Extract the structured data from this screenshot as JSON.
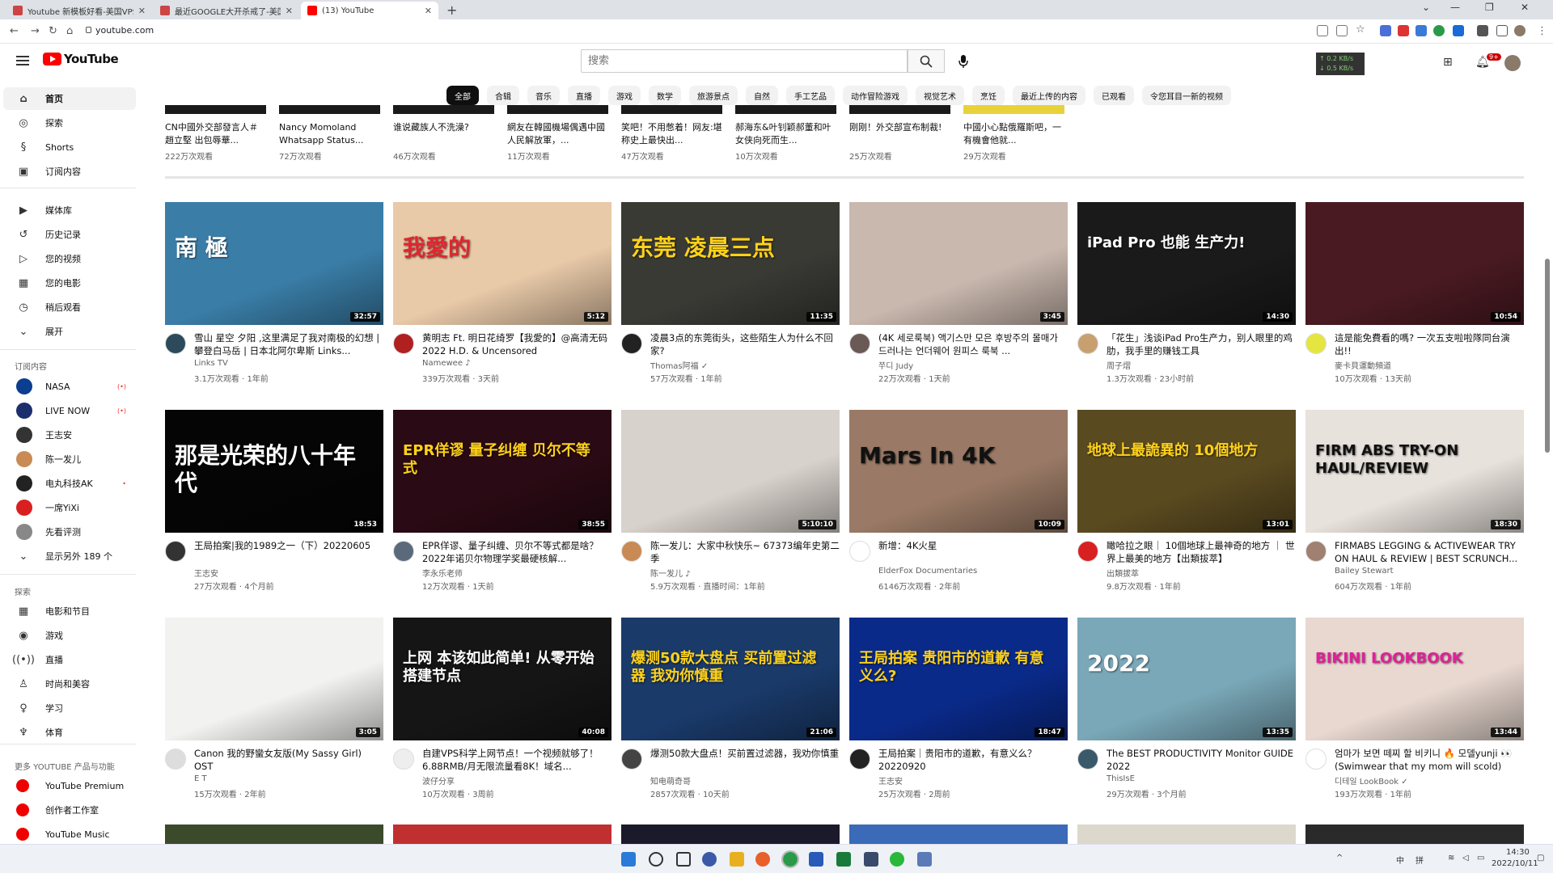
{
  "browser": {
    "tabs": [
      {
        "title": "Youtube 新模板好看-美国VPS..."
      },
      {
        "title": "最近GOOGLE大开杀戒了-美国V..."
      },
      {
        "title": "(13) YouTube"
      }
    ],
    "url": "youtube.com",
    "window_controls": {
      "minimize": "—",
      "restore": "❐",
      "close": "✕",
      "chevron": "⌄"
    }
  },
  "header": {
    "logo_text": "YouTube",
    "search_placeholder": "搜索",
    "net_speed_up": "↑ 0.2 KB/s",
    "net_speed_down": "↓ 0.5 KB/s",
    "notifications_badge": "9+"
  },
  "sidebar": {
    "main": [
      {
        "label": "首页",
        "icon": "home-icon",
        "glyph": "⌂"
      },
      {
        "label": "探索",
        "icon": "compass-icon",
        "glyph": "◎"
      },
      {
        "label": "Shorts",
        "icon": "shorts-icon",
        "glyph": "§"
      },
      {
        "label": "订阅内容",
        "icon": "subscriptions-icon",
        "glyph": "▣"
      }
    ],
    "library": [
      {
        "label": "媒体库",
        "icon": "library-icon",
        "glyph": "▶"
      },
      {
        "label": "历史记录",
        "icon": "history-icon",
        "glyph": "↺"
      },
      {
        "label": "您的视频",
        "icon": "your-videos-icon",
        "glyph": "▷"
      },
      {
        "label": "您的电影",
        "icon": "movies-icon",
        "glyph": "▦"
      },
      {
        "label": "稍后观看",
        "icon": "watch-later-icon",
        "glyph": "◷"
      },
      {
        "label": "展开",
        "icon": "chevron-down-icon",
        "glyph": "⌄"
      }
    ],
    "subscriptions_heading": "订阅内容",
    "subscriptions": [
      {
        "label": "NASA",
        "color": "#0b3d91",
        "live": "(•)"
      },
      {
        "label": "LIVE NOW",
        "color": "#1a2f6b",
        "live": "(•)"
      },
      {
        "label": "王志安",
        "color": "#333333",
        "live": ""
      },
      {
        "label": "陈一发儿",
        "color": "#c98a55",
        "live": ""
      },
      {
        "label": "电丸科技AK",
        "color": "#222222",
        "live": "•"
      },
      {
        "label": "一席YiXi",
        "color": "#d92020",
        "live": ""
      },
      {
        "label": "先看评测",
        "color": "#888888",
        "live": ""
      },
      {
        "label": "显示另外 189 个",
        "color": "",
        "live": ""
      }
    ],
    "explore_heading": "探索",
    "explore": [
      {
        "label": "电影和节目",
        "icon": "film-icon",
        "glyph": "▦"
      },
      {
        "label": "游戏",
        "icon": "gaming-icon",
        "glyph": "◉"
      },
      {
        "label": "直播",
        "icon": "live-icon",
        "glyph": "((•))"
      },
      {
        "label": "时尚和美容",
        "icon": "fashion-icon",
        "glyph": "♙"
      },
      {
        "label": "学习",
        "icon": "learning-icon",
        "glyph": "♀"
      },
      {
        "label": "体育",
        "icon": "sports-icon",
        "glyph": "♆"
      }
    ],
    "more_heading": "更多 YOUTUBE 产品与功能",
    "more": [
      {
        "label": "YouTube Premium"
      },
      {
        "label": "创作者工作室"
      },
      {
        "label": "YouTube Music"
      }
    ]
  },
  "chips": [
    "全部",
    "合辑",
    "音乐",
    "直播",
    "游戏",
    "数学",
    "旅游景点",
    "自然",
    "手工艺品",
    "动作冒险游戏",
    "视觉艺术",
    "烹饪",
    "最近上传的内容",
    "已观看",
    "令您耳目一新的视频"
  ],
  "shorts": [
    {
      "title": "CN中國外交部發言人＃趙立堅 出包辱華...",
      "views": "222万次观看"
    },
    {
      "title": "Nancy Momoland Whatsapp Status...",
      "views": "72万次观看"
    },
    {
      "title": "谁说藏族人不洗澡?",
      "views": "46万次观看"
    },
    {
      "title": "網友在韓國機場偶遇中國人民解放軍，...",
      "views": "11万次观看"
    },
    {
      "title": "笑吧！不用憋着！网友:堪称史上最快出...",
      "views": "47万次观看"
    },
    {
      "title": "郝海东&叶钊颖郝董和叶女侠向死而生...",
      "views": "10万次观看"
    },
    {
      "title": "刚刚！外交部宣布制裁!",
      "views": "25万次观看"
    },
    {
      "title": "中國小心點俄羅斯吧，一有機會他就...",
      "views": "29万次观看"
    }
  ],
  "videos": [
    {
      "title": "雪山 星空 夕阳 ,这里满足了我对南极的幻想 | 攀登白马岳 | 日本北阿尔卑斯 Links...",
      "channel": "Links TV",
      "meta": "3.1万次观看 · 1年前",
      "duration": "32:57",
      "thumb_text": "南 極",
      "bg": "#3a7ea8",
      "fg": "#ffffff",
      "avatar": "#2c4a5a"
    },
    {
      "title": "黄明志 Ft. 明日花绮罗【我愛的】@高清无码 2022 H.D. & Uncensored",
      "channel": "Namewee ♪",
      "meta": "339万次观看 · 3天前",
      "duration": "5:12",
      "thumb_text": "我愛的",
      "bg": "#e8c9a8",
      "fg": "#e0262e",
      "avatar": "#b02020"
    },
    {
      "title": "凌晨3点的东莞街头，这些陌生人为什么不回家?",
      "channel": "Thomas阿福 ✓",
      "meta": "57万次观看 · 1年前",
      "duration": "11:35",
      "thumb_text": "东莞 凌晨三点",
      "bg": "#3a3a35",
      "fg": "#ffd21a",
      "avatar": "#222222"
    },
    {
      "title": "(4K 세로룩북) 액기스만 모은 후방주의 몰매가 드러나는 언더웨어 원피스 룩북 ...",
      "channel": "쭈디 Judy",
      "meta": "22万次观看 · 1天前",
      "duration": "3:45",
      "thumb_text": "",
      "bg": "#c9b8ae",
      "fg": "#ffffff",
      "avatar": "#6a5a55"
    },
    {
      "title": "「花生」浅谈iPad Pro生产力，别人眼里的鸡肋，我手里的赚钱工具",
      "channel": "周子熠",
      "meta": "1.3万次观看 · 23小时前",
      "duration": "14:30",
      "thumb_text": "iPad Pro 也能 生产力!",
      "bg": "#1a1a1a",
      "fg": "#ffffff",
      "avatar": "#c8a070"
    },
    {
      "title": "這是能免費看的嗎? 一次五支啦啦隊同台演出!!",
      "channel": "麥卡貝運動頻道",
      "meta": "10万次观看 · 13天前",
      "duration": "10:54",
      "thumb_text": "",
      "bg": "#4a1a22",
      "fg": "#ffffff",
      "avatar": "#e5e540"
    },
    {
      "title": "王局拍案|我的1989之一（下）20220605",
      "channel": "王志安",
      "meta": "27万次观看 · 4个月前",
      "duration": "18:53",
      "thumb_text": "那是光荣的八十年代",
      "bg": "#050505",
      "fg": "#ffffff",
      "avatar": "#333333"
    },
    {
      "title": "EPR佯谬、量子纠缠、贝尔不等式都是啥？2022年诺贝尔物理学奖最硬核解...",
      "channel": "李永乐老师",
      "meta": "12万次观看 · 1天前",
      "duration": "38:55",
      "thumb_text": "EPR佯谬 量子纠缠 贝尔不等式",
      "bg": "#2a0a14",
      "fg": "#ffd21a",
      "avatar": "#5a6a7a"
    },
    {
      "title": "陈一发儿：大家中秋快乐~ 67373编年史第二季",
      "channel": "陈一发儿 ♪",
      "meta": "5.9万次观看 · 直播时间：1年前",
      "duration": "5:10:10",
      "thumb_text": "",
      "bg": "#d8d2cc",
      "fg": "#ffffff",
      "avatar": "#c98a55"
    },
    {
      "title": "新增：4K火星",
      "channel": "ElderFox Documentaries",
      "meta": "6146万次观看 · 2年前",
      "duration": "10:09",
      "thumb_text": "Mars In 4K",
      "bg": "#9a7a66",
      "fg": "#111111",
      "avatar": "#ffffff"
    },
    {
      "title": "瞰哈拉之眼｜ 10個地球上最神奇的地方 ｜ 世界上最美的地方【出類拔萃】",
      "channel": "出類拔萃",
      "meta": "9.8万次观看 · 1年前",
      "duration": "13:01",
      "thumb_text": "地球上最詭異的 10個地方",
      "bg": "#5a4a20",
      "fg": "#ffd21a",
      "avatar": "#d92020"
    },
    {
      "title": "FIRMABS LEGGING & ACTIVEWEAR TRY ON HAUL & REVIEW | BEST SCRUNCH...",
      "channel": "Bailey Stewart",
      "meta": "604万次观看 · 1年前",
      "duration": "18:30",
      "thumb_text": "FIRM ABS  TRY-ON HAUL/REVIEW",
      "bg": "#e8e2dc",
      "fg": "#111111",
      "avatar": "#a08070"
    },
    {
      "title": "Canon 我的野蠻女友版(My Sassy Girl) OST",
      "channel": "E T",
      "meta": "15万次观看 · 2年前",
      "duration": "3:05",
      "thumb_text": "",
      "bg": "#f2f2f0",
      "fg": "#111111",
      "avatar": "#dddddd"
    },
    {
      "title": "自建VPS科学上网节点！一个视频就够了！6.88RMB/月无限流量看8K！域名...",
      "channel": "波仔分享",
      "meta": "10万次观看 · 3周前",
      "duration": "40:08",
      "thumb_text": "上网 本该如此简单! 从零开始搭建节点",
      "bg": "#151515",
      "fg": "#ffffff",
      "avatar": "#eeeeee"
    },
    {
      "title": "爆测50款大盘点！买前置过滤器，我劝你慎重",
      "channel": "知电萌奇哥",
      "meta": "2857次观看 · 10天前",
      "duration": "21:06",
      "thumb_text": "爆测50款大盘点 买前置过滤器 我劝你慎重",
      "bg": "#1a3a6a",
      "fg": "#ffd21a",
      "avatar": "#444444"
    },
    {
      "title": "王局拍案｜贵阳市的道歉，有意义么？20220920",
      "channel": "王志安",
      "meta": "25万次观看 · 2周前",
      "duration": "18:47",
      "thumb_text": "王局拍案 贵阳市的道歉 有意义么?",
      "bg": "#0a2a8a",
      "fg": "#ffd21a",
      "avatar": "#222222"
    },
    {
      "title": "The BEST PRODUCTIVITY Monitor GUIDE 2022",
      "channel": "ThisIsE",
      "meta": "29万次观看 · 3个月前",
      "duration": "13:35",
      "thumb_text": "2022",
      "bg": "#7aa8b8",
      "fg": "#ffffff",
      "avatar": "#3a5a6a"
    },
    {
      "title": "엄마가 보면 떼찌 할 비키니 🔥 모델yunji 👀 (Swimwear that my mom will scold)",
      "channel": "디테일 LookBook ✓",
      "meta": "193万次观看 · 1年前",
      "duration": "13:44",
      "thumb_text": "BIKINI LOOKBOOK",
      "bg": "#e8d8d0",
      "fg": "#e0209a",
      "avatar": "#ffffff"
    }
  ],
  "taskbar": {
    "ime_lang": "中",
    "ime_mode": "拼",
    "time": "14:30",
    "date": "2022/10/11"
  }
}
